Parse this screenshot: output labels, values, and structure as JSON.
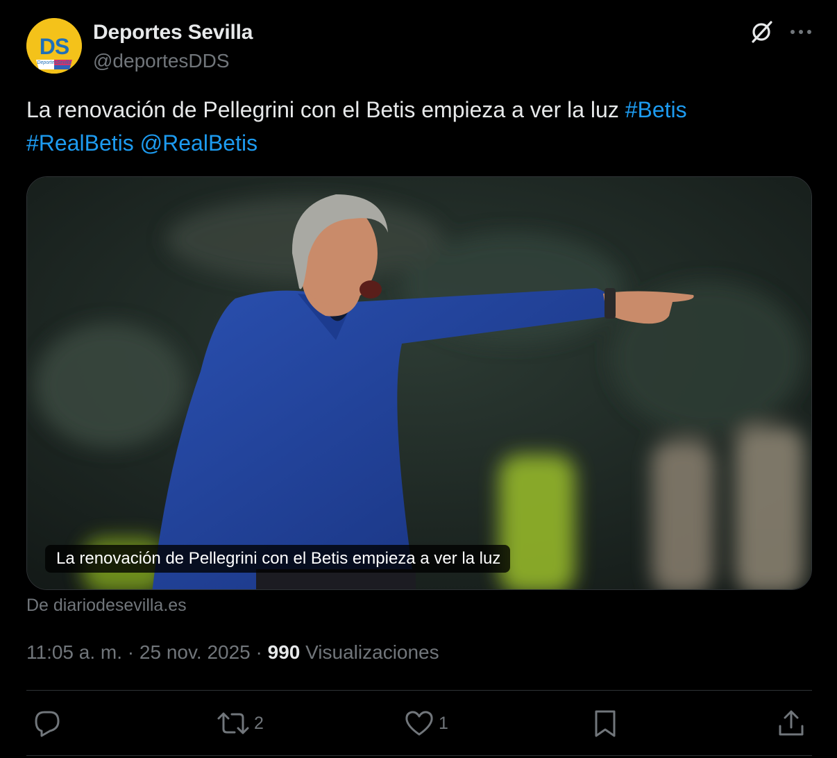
{
  "author": {
    "name": "Deportes Sevilla",
    "handle": "@deportesDDS",
    "avatar_initials": "DS",
    "avatar_subtext": "DeportesSevilla"
  },
  "post": {
    "text": "La renovación de Pellegrini con el Betis empieza a ver la luz ",
    "hashtag_1": "#Betis",
    "hashtag_2": "#RealBetis",
    "mention": "@RealBetis",
    "link_color": "#1d9bf0"
  },
  "media": {
    "caption": "La renovación de Pellegrini con el Betis empieza a ver la luz",
    "source": "De diariodesevilla.es"
  },
  "meta": {
    "time": "11:05 a. m.",
    "separator": " · ",
    "date": "25 nov. 2025",
    "views_count": "990",
    "views_label": "Visualizaciones"
  },
  "actions": {
    "reply_icon": "reply-icon",
    "retweet_icon": "retweet-icon",
    "retweet_count": "2",
    "like_icon": "heart-icon",
    "like_count": "1",
    "bookmark_icon": "bookmark-icon",
    "share_icon": "share-icon"
  },
  "colors": {
    "background": "#000000",
    "text_primary": "#e7e9ea",
    "text_secondary": "#71767b",
    "divider": "#2f3336",
    "avatar_yellow": "#f4c21a",
    "avatar_blue": "#1f6fb8"
  }
}
